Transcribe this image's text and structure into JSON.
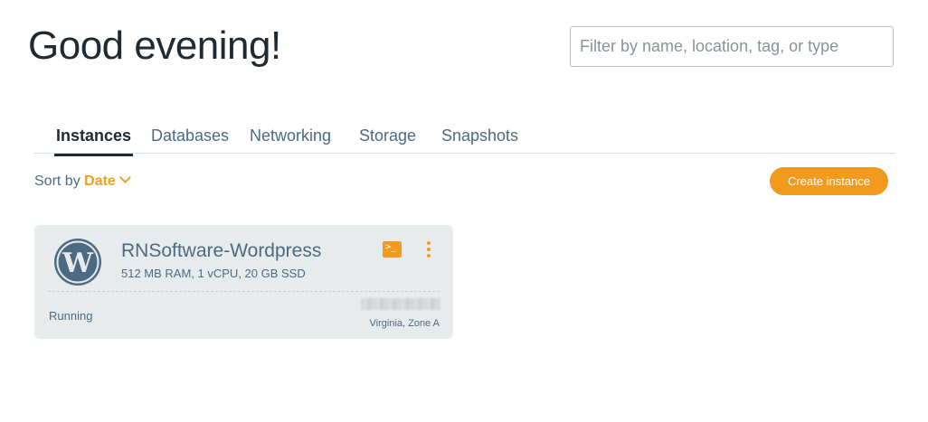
{
  "header": {
    "greeting": "Good evening!",
    "filter_placeholder": "Filter by name, location, tag, or type"
  },
  "tabs": [
    {
      "label": "Instances",
      "active": true
    },
    {
      "label": "Databases",
      "active": false
    },
    {
      "label": "Networking",
      "active": false
    },
    {
      "label": "Storage",
      "active": false
    },
    {
      "label": "Snapshots",
      "active": false
    }
  ],
  "toolbar": {
    "sort_prefix": "Sort by",
    "sort_value": "Date",
    "create_label": "Create instance"
  },
  "instances": [
    {
      "name": "RNSoftware-Wordpress",
      "specs": "512 MB RAM, 1 vCPU, 20 GB SSD",
      "status": "Running",
      "location": "Virginia, Zone A",
      "icon": "wordpress-logo-icon"
    }
  ],
  "colors": {
    "accent": "#f29a1e",
    "link": "#4c6a82",
    "heading": "#1f2a33",
    "card_bg": "#e8ebec"
  }
}
